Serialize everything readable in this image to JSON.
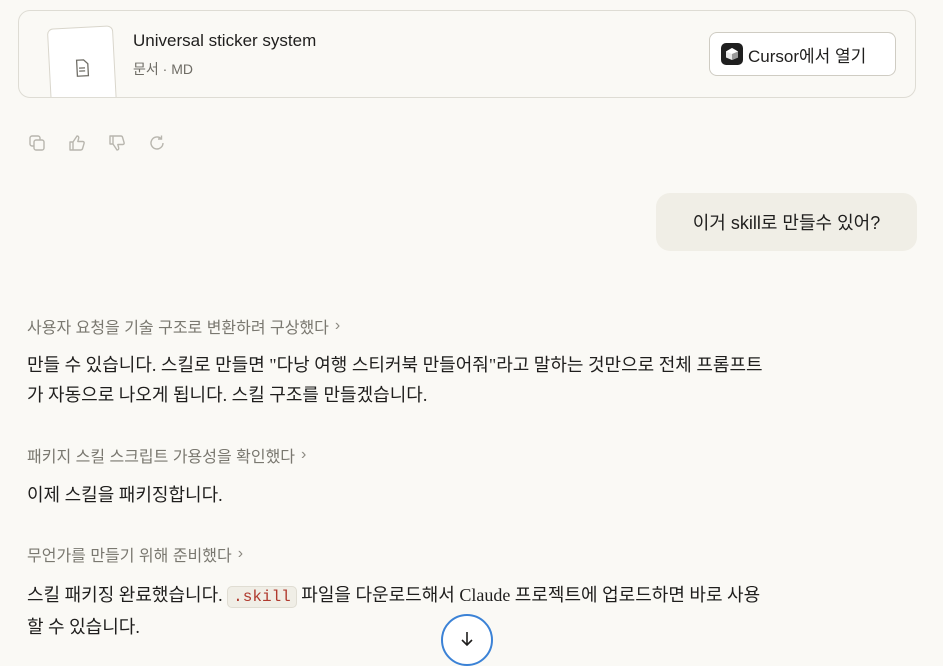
{
  "file_card": {
    "title": "Universal sticker system",
    "meta": "문서 · MD",
    "open_button_label": "Cursor에서 열기"
  },
  "message_actions": {
    "icons": [
      "copy-icon",
      "thumbs-up-icon",
      "thumbs-down-icon",
      "retry-icon"
    ]
  },
  "user_message": "이거 skill로 만들수 있어?",
  "assistant": {
    "thought_1": "사용자 요청을 기술 구조로 변환하려 구상했다",
    "para_1_line_1": "만들 수 있습니다. 스킬로 만들면 \"다낭 여행 스티커북 만들어줘\"라고 말하는 것만으로 전체 프롬프트",
    "para_1_line_2": "가 자동으로 나오게 됩니다. 스킬 구조를 만들겠습니다.",
    "thought_2": "패키지 스킬 스크립트 가용성을 확인했다",
    "para_2": "이제 스킬을 패키징합니다.",
    "thought_3": "무언가를 만들기 위해 준비했다",
    "para_3_before": "스킬 패키징 완료했습니다. ",
    "para_3_code": ".skill",
    "para_3_after": " 파일을 다운로드해서 Claude 프로젝트에 업로드하면 바로 사용",
    "para_3_line_2": "할 수 있습니다."
  },
  "colors": {
    "background": "#faf9f5",
    "bubble": "#f0eee6",
    "scroll_ring": "#3b82d6"
  }
}
